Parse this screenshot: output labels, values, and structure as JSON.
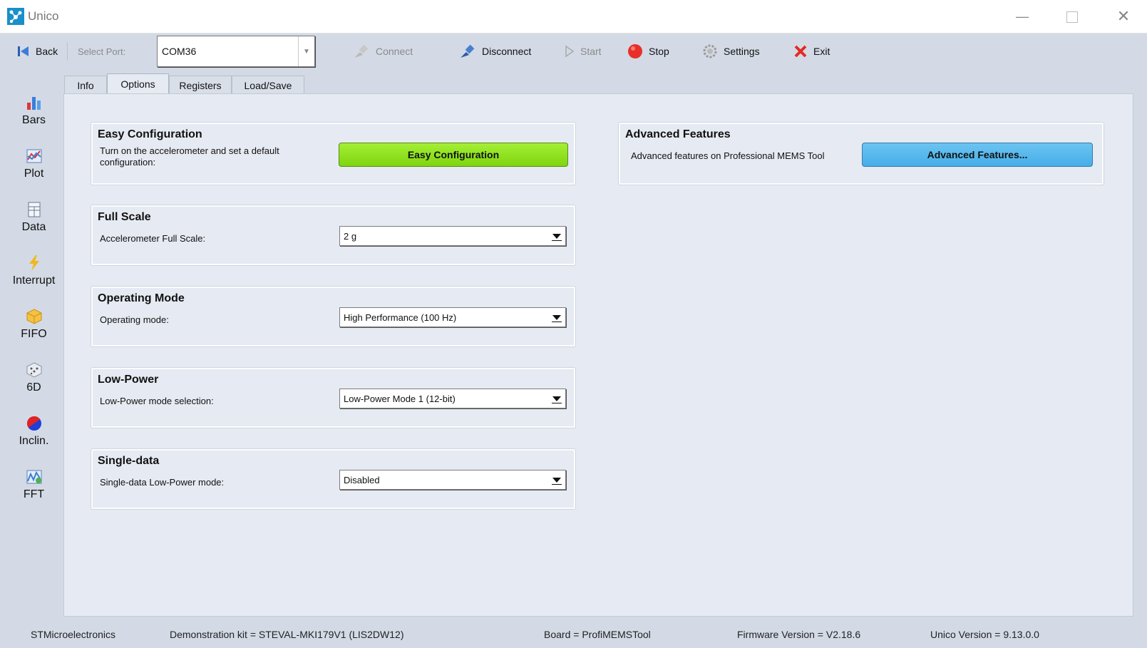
{
  "window": {
    "title": "Unico",
    "minimize_glyph": "—",
    "close_glyph": "✕"
  },
  "toolbar": {
    "back_label": "Back",
    "select_port_label": "Select Port:",
    "port_value": "COM36",
    "connect_label": "Connect",
    "disconnect_label": "Disconnect",
    "start_label": "Start",
    "stop_label": "Stop",
    "settings_label": "Settings",
    "exit_label": "Exit"
  },
  "sidebar": {
    "items": [
      {
        "label": "Bars",
        "icon": "bar-chart-icon"
      },
      {
        "label": "Plot",
        "icon": "plot-icon"
      },
      {
        "label": "Data",
        "icon": "data-table-icon"
      },
      {
        "label": "Interrupt",
        "icon": "lightning-icon"
      },
      {
        "label": "FIFO",
        "icon": "fifo-box-icon"
      },
      {
        "label": "6D",
        "icon": "dice-icon"
      },
      {
        "label": "Inclin.",
        "icon": "inclination-ball-icon"
      },
      {
        "label": "FFT",
        "icon": "fft-icon"
      }
    ]
  },
  "tabs": {
    "items": [
      "Info",
      "Options",
      "Registers",
      "Load/Save"
    ],
    "active": "Options"
  },
  "groups": {
    "easy_config": {
      "title": "Easy Configuration",
      "description": "Turn on the accelerometer and set a default configuration:",
      "button": "Easy Configuration"
    },
    "advanced": {
      "title": "Advanced Features",
      "description": "Advanced features on Professional MEMS Tool",
      "button": "Advanced Features..."
    },
    "full_scale": {
      "title": "Full Scale",
      "label": "Accelerometer Full Scale:",
      "value": "2 g"
    },
    "operating_mode": {
      "title": "Operating Mode",
      "label": "Operating mode:",
      "value": "High Performance (100 Hz)"
    },
    "low_power": {
      "title": "Low-Power",
      "label": "Low-Power mode selection:",
      "value": "Low-Power Mode 1 (12-bit)"
    },
    "single_data": {
      "title": "Single-data",
      "label": "Single-data Low-Power mode:",
      "value": "Disabled"
    }
  },
  "status": {
    "company": "STMicroelectronics",
    "kit": "Demonstration kit = STEVAL-MKI179V1 (LIS2DW12)",
    "board": "Board = ProfiMEMSTool",
    "firmware": "Firmware Version = V2.18.6",
    "unico_version": "Unico Version = 9.13.0.0"
  },
  "colors": {
    "easy_button": "#8be01e",
    "advanced_button": "#52b5ec",
    "background": "#d3dae5",
    "panel": "#e6eaf2"
  }
}
